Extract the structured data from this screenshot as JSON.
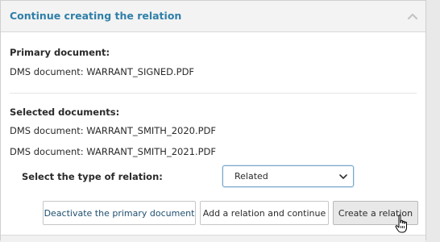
{
  "header": {
    "title": "Continue creating the relation",
    "collapse_icon": "chevron-up-icon"
  },
  "primary": {
    "label": "Primary document:",
    "document": "DMS document: WARRANT_SIGNED.PDF"
  },
  "selected": {
    "label": "Selected documents:",
    "documents": [
      "DMS document: WARRANT_SMITH_2020.PDF",
      "DMS document: WARRANT_SMITH_2021.PDF"
    ]
  },
  "relation_type": {
    "label": "Select the type of relation:",
    "selected_value": "Related",
    "dropdown_icon": "chevron-down-icon"
  },
  "actions": {
    "deactivate_label": "Deactivate the primary document",
    "add_continue_label": "Add a relation and continue",
    "create_label": "Create a relation"
  },
  "colors": {
    "title": "#2f7fa8",
    "select_border": "#7aa8c8",
    "hover_button": "#e8e8e8"
  },
  "cursor_icon": "hand-pointer-icon"
}
